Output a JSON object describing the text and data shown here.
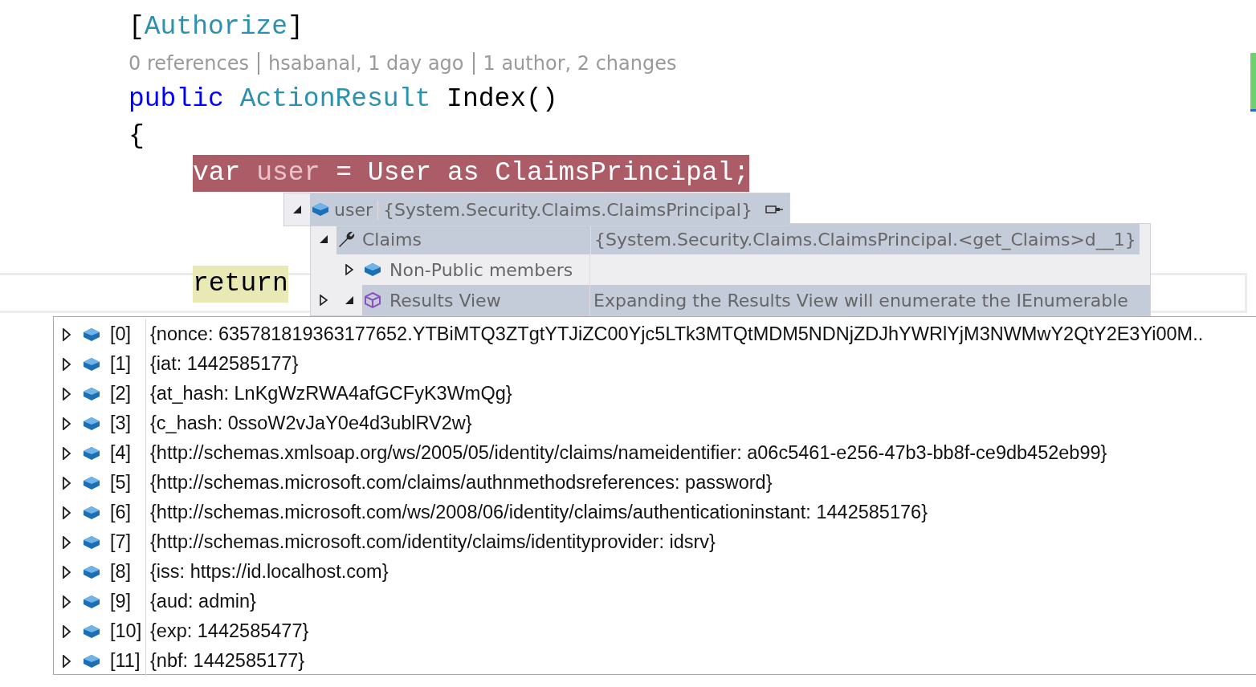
{
  "editor": {
    "lines": [
      {
        "kind": "member",
        "breakpoint": false,
        "current": false,
        "tokens": [
          {
            "kind": "plain",
            "text": "["
          },
          {
            "kind": "type",
            "text": "Authorize"
          },
          {
            "kind": "plain",
            "text": "]"
          }
        ]
      },
      {
        "kind": "lens",
        "parts": [
          "0 references",
          "hsabanal, 1 day ago",
          "1 author, 2 changes"
        ]
      },
      {
        "kind": "member",
        "breakpoint": false,
        "current": false,
        "tokens": [
          {
            "kind": "keyword",
            "text": "public"
          },
          {
            "kind": "type",
            "text": " ActionResult"
          },
          {
            "kind": "plain",
            "text": " Index()"
          }
        ]
      },
      {
        "kind": "member",
        "breakpoint": false,
        "current": false,
        "tokens": [
          {
            "kind": "plain",
            "text": "{"
          }
        ]
      },
      {
        "kind": "statement",
        "breakpoint": true,
        "current": false,
        "tokens": [
          {
            "kind": "keyword",
            "text": "var"
          },
          {
            "kind": "local",
            "text": " user"
          },
          {
            "kind": "plain",
            "text": " = User "
          },
          {
            "kind": "keyword",
            "text": "as"
          },
          {
            "kind": "plain",
            "text": " ClaimsPrincipal;"
          }
        ]
      },
      {
        "kind": "blank"
      },
      {
        "kind": "blank"
      },
      {
        "kind": "statement",
        "breakpoint": false,
        "current": true,
        "tokens": [
          {
            "kind": "keyword",
            "text": "return"
          }
        ]
      }
    ]
  },
  "datatip": {
    "name": "user",
    "value": "{System.Security.Claims.ClaimsPrincipal}",
    "kind": "object",
    "expanded": true,
    "selected": true,
    "children": [
      {
        "name": "Claims",
        "value": "{System.Security.Claims.ClaimsPrincipal.<get_Claims>d__1}",
        "kind": "property",
        "expanded": true,
        "selected": true,
        "children": [
          {
            "name": "Non-Public members",
            "kind": "object",
            "expanded": false,
            "selected": false
          },
          {
            "name": "Results View",
            "value": "Expanding the Results View will enumerate the IEnumerable",
            "kind": "results",
            "expanded": true,
            "selected": true,
            "children": [
              {
                "name": "[0]",
                "value": "{nonce: 635781819363177652.YTBiMTQ3ZTgtYTJiZC00Yjc5LTk3MTQtMDM5NDNjZDJhYWRlYjM3NWMwY2QtY2E3Yi00M..",
                "kind": "object",
                "expanded": false
              },
              {
                "name": "[1]",
                "value": "{iat: 1442585177}",
                "kind": "object",
                "expanded": false
              },
              {
                "name": "[2]",
                "value": "{at_hash: LnKgWzRWA4afGCFyK3WmQg}",
                "kind": "object",
                "expanded": false
              },
              {
                "name": "[3]",
                "value": "{c_hash: 0ssoW2vJaY0e4d3ublRV2w}",
                "kind": "object",
                "expanded": false
              },
              {
                "name": "[4]",
                "value": "{http://schemas.xmlsoap.org/ws/2005/05/identity/claims/nameidentifier: a06c5461-e256-47b3-bb8f-ce9db452eb99}",
                "kind": "object",
                "expanded": false
              },
              {
                "name": "[5]",
                "value": "{http://schemas.microsoft.com/claims/authnmethodsreferences: password}",
                "kind": "object",
                "expanded": false
              },
              {
                "name": "[6]",
                "value": "{http://schemas.microsoft.com/ws/2008/06/identity/claims/authenticationinstant: 1442585176}",
                "kind": "object",
                "expanded": false
              },
              {
                "name": "[7]",
                "value": "{http://schemas.microsoft.com/identity/claims/identityprovider: idsrv}",
                "kind": "object",
                "expanded": false
              },
              {
                "name": "[8]",
                "value": "{iss: https://id.localhost.com}",
                "kind": "object",
                "expanded": false
              },
              {
                "name": "[9]",
                "value": "{aud: admin}",
                "kind": "object",
                "expanded": false
              },
              {
                "name": "[10]",
                "value": "{exp: 1442585477}",
                "kind": "object",
                "expanded": false
              },
              {
                "name": "[11]",
                "value": "{nbf: 1442585177}",
                "kind": "object",
                "expanded": false
              }
            ]
          }
        ]
      }
    ]
  }
}
